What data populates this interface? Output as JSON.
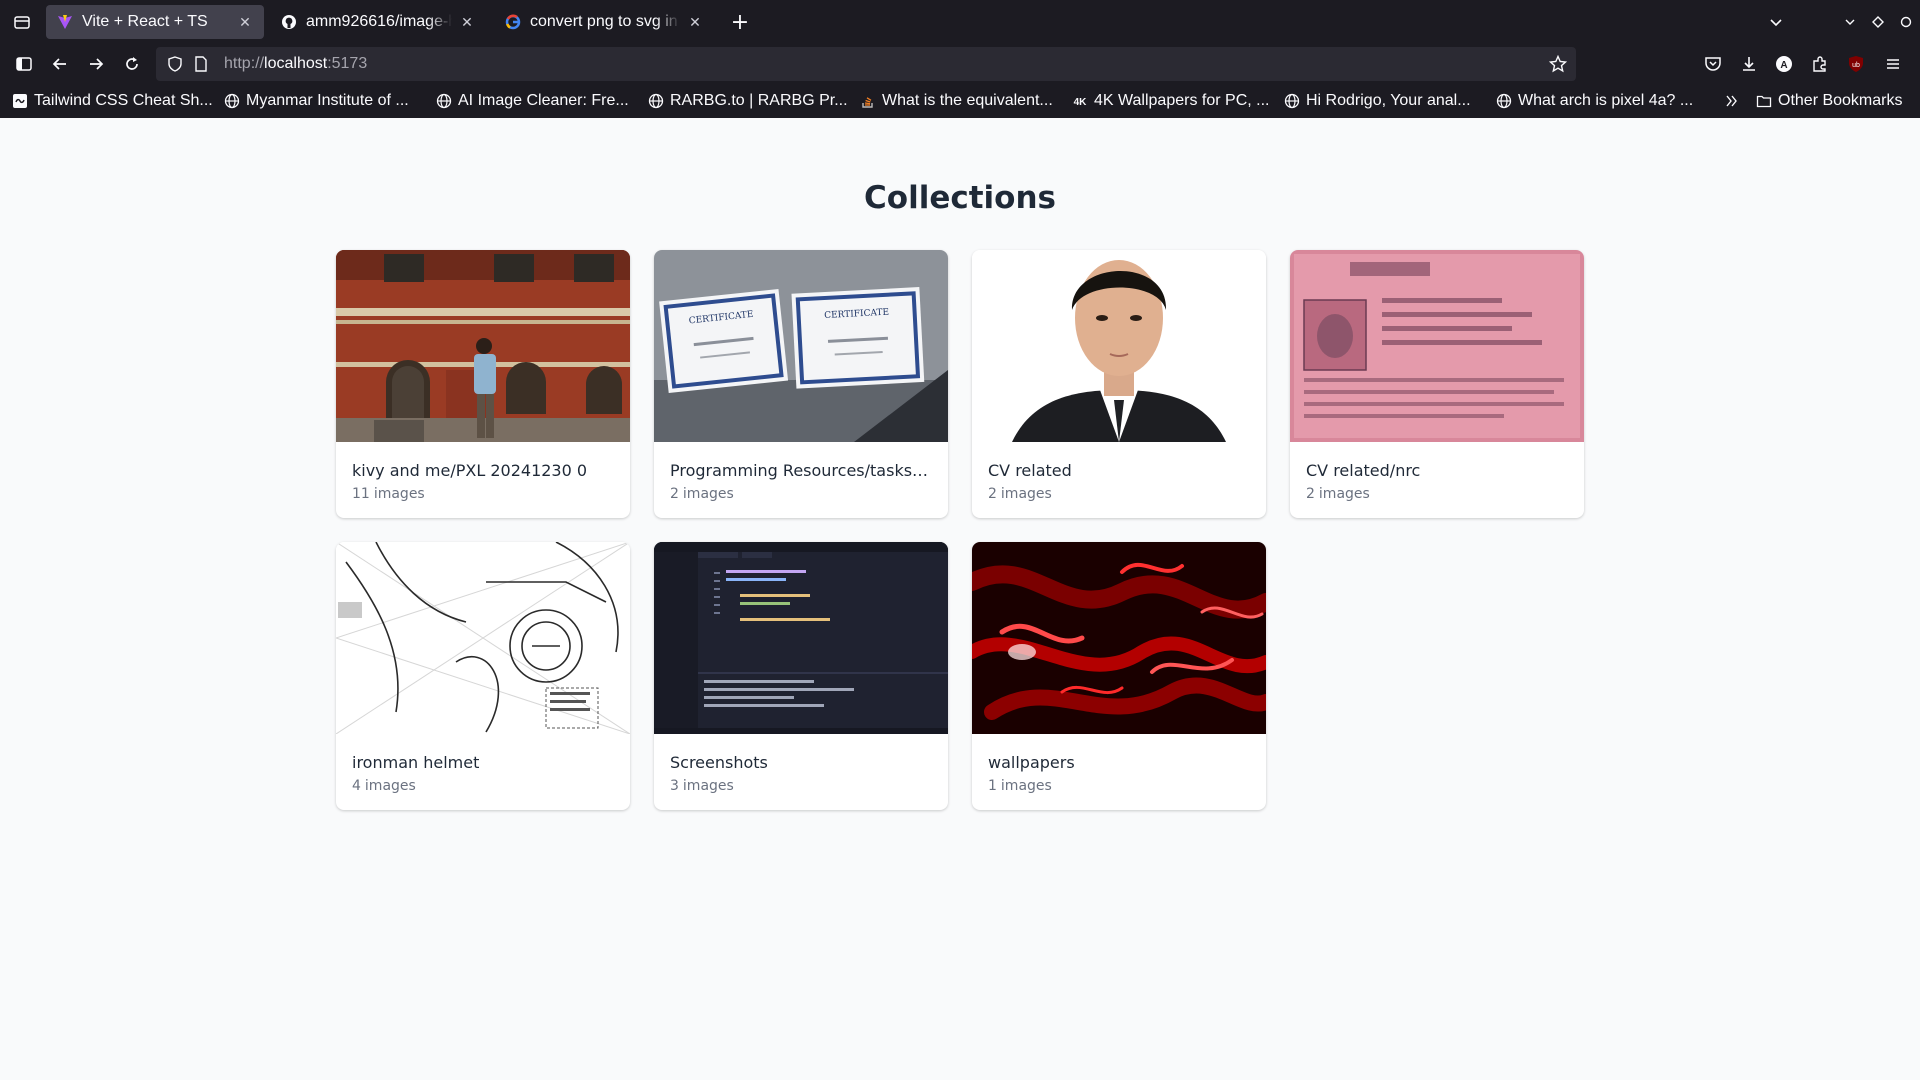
{
  "browser": {
    "tabs": [
      {
        "title": "Vite + React + TS",
        "favicon": "vite-icon",
        "active": true
      },
      {
        "title": "amm926616/image-h",
        "favicon": "github-icon",
        "active": false
      },
      {
        "title": "convert png to svg in",
        "favicon": "google-icon",
        "active": false
      }
    ],
    "url": {
      "prefix": "http://",
      "host": "localhost",
      "port": ":5173"
    },
    "bookmarks": [
      {
        "label": "Tailwind CSS Cheat Sh...",
        "icon": "tailwind-icon"
      },
      {
        "label": "Myanmar Institute of ...",
        "icon": "globe-icon"
      },
      {
        "label": "AI Image Cleaner: Fre...",
        "icon": "globe-icon"
      },
      {
        "label": "RARBG.to | RARBG Pr...",
        "icon": "globe-icon"
      },
      {
        "label": "What is the equivalent...",
        "icon": "stackoverflow-icon"
      },
      {
        "label": "4K Wallpapers for PC, ...",
        "icon": "wallpaper-site-icon"
      },
      {
        "label": "Hi Rodrigo,  Your anal...",
        "icon": "globe-icon"
      },
      {
        "label": "What arch is pixel 4a? ...",
        "icon": "globe-icon"
      }
    ],
    "other_bookmarks": "Other Bookmarks"
  },
  "page": {
    "title": "Collections",
    "count_suffix": "images",
    "collections": [
      {
        "name": "kivy and me/PXL 20241230 0",
        "count": "11",
        "thumbnail": "photo-building"
      },
      {
        "name": "Programming Resources/tasks o...",
        "count": "2",
        "thumbnail": "photo-certificates"
      },
      {
        "name": "CV related",
        "count": "2",
        "thumbnail": "photo-portrait"
      },
      {
        "name": "CV related/nrc",
        "count": "2",
        "thumbnail": "photo-id-card"
      },
      {
        "name": "ironman helmet",
        "count": "4",
        "thumbnail": "sketch-helmet"
      },
      {
        "name": "Screenshots",
        "count": "3",
        "thumbnail": "screenshot-editor"
      },
      {
        "name": "wallpapers",
        "count": "1",
        "thumbnail": "red-abstract"
      }
    ]
  },
  "colors": {
    "chrome_bg": "#1c1b22",
    "active_tab": "#42414d",
    "urlbar_bg": "#2b2a33",
    "page_bg": "#f9fafb",
    "card_bg": "#ffffff",
    "title_text": "#1f2937",
    "muted_text": "#6b7280"
  }
}
